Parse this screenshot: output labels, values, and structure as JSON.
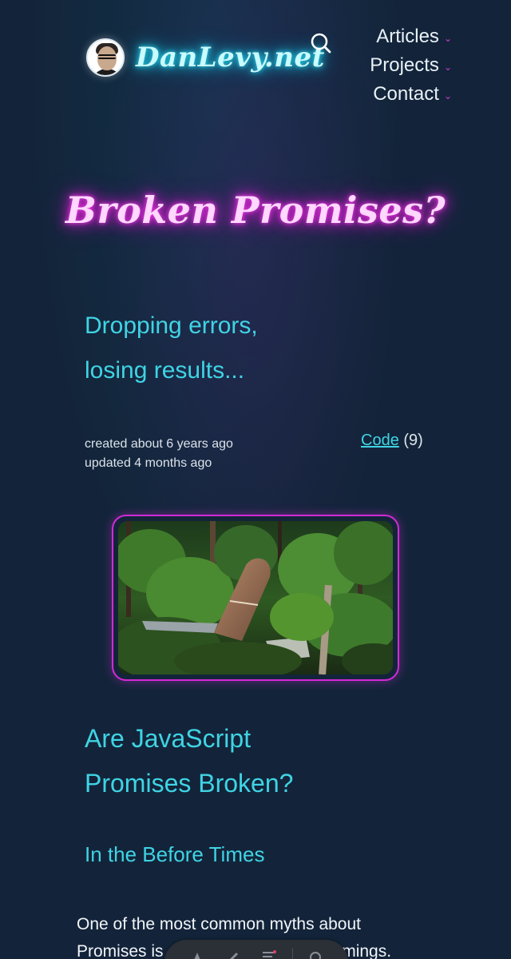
{
  "header": {
    "site_name": "DanLevy.net",
    "nav": [
      {
        "label": "Articles"
      },
      {
        "label": "Projects"
      },
      {
        "label": "Contact"
      }
    ]
  },
  "post": {
    "title": "Broken Promises?",
    "subtitle_line1": "Dropping errors,",
    "subtitle_line2": "losing results...",
    "created": "created about 6 years ago",
    "updated": "updated 4 months ago",
    "category_link": "Code",
    "category_count": "(9)",
    "section_line1": "Are JavaScript",
    "section_line2": "Promises Broken?",
    "subsection": "In the Before Times",
    "body_line1": "One of the most common myths about",
    "body_line2_start": "Promises is",
    "body_line2_end": "omings."
  },
  "colors": {
    "background": "#13243a",
    "accent_cyan": "#3fd4e4",
    "neon_pink": "#e21fd8",
    "image_border": "#d22ad6"
  },
  "icons": {
    "search": "search-icon",
    "nav_chevron": "chevron-down-icon"
  }
}
